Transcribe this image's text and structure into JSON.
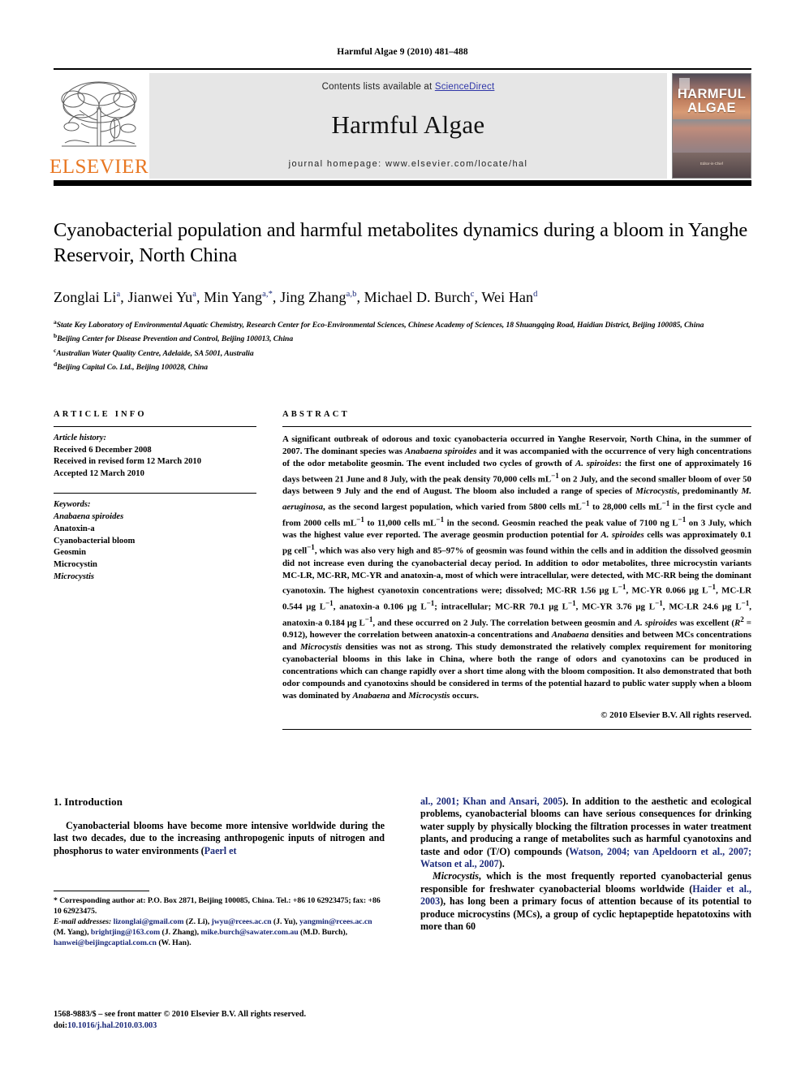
{
  "running_head": "Harmful Algae 9 (2010) 481–488",
  "masthead": {
    "contents_prefix": "Contents lists available at ",
    "sciencedirect": "ScienceDirect",
    "journal_title": "Harmful Algae",
    "homepage": "journal homepage: www.elsevier.com/locate/hal",
    "publisher_wordmark": "ELSEVIER",
    "cover": {
      "line1": "HARMFUL",
      "line2": "ALGAE",
      "footer": "Editor-in-Chief"
    }
  },
  "article": {
    "title": "Cyanobacterial population and harmful metabolites dynamics during a bloom in Yanghe Reservoir, North China",
    "authors_html": "Zonglai Li<sup>a</sup>, Jianwei Yu<sup>a</sup>, Min Yang<sup>a,*</sup>, Jing Zhang<sup>a,b</sup>, Michael D. Burch<sup>c</sup>, Wei Han<sup>d</sup>",
    "affiliations": [
      "<sup>a</sup>State Key Laboratory of Environmental Aquatic Chemistry, Research Center for Eco-Environmental Sciences, Chinese Academy of Sciences, 18 Shuangqing Road, Haidian District, Beijing 100085, China",
      "<sup>b</sup>Beijing Center for Disease Prevention and Control, Beijing 100013, China",
      "<sup>c</sup>Australian Water Quality Centre, Adelaide, SA 5001, Australia",
      "<sup>d</sup>Beijing Capital Co. Ltd., Beijing 100028, China"
    ]
  },
  "article_info": {
    "heading": "ARTICLE INFO",
    "history_label": "Article history:",
    "history": [
      "Received 6 December 2008",
      "Received in revised form 12 March 2010",
      "Accepted 12 March 2010"
    ],
    "keywords_label": "Keywords:",
    "keywords": [
      {
        "text": "Anabaena spiroides",
        "italic": true
      },
      {
        "text": "Anatoxin-a",
        "italic": false
      },
      {
        "text": "Cyanobacterial bloom",
        "italic": false
      },
      {
        "text": "Geosmin",
        "italic": false
      },
      {
        "text": "Microcystin",
        "italic": false
      },
      {
        "text": "Microcystis",
        "italic": true
      }
    ]
  },
  "abstract": {
    "heading": "ABSTRACT",
    "text_html": "A significant outbreak of odorous and toxic cyanobacteria occurred in Yanghe Reservoir, North China, in the summer of 2007. The dominant species was <i>Anabaena spiroides</i> and it was accompanied with the occurrence of very high concentrations of the odor metabolite geosmin. The event included two cycles of growth of <i>A. spiroides</i>: the first one of approximately 16 days between 21 June and 8 July, with the peak density 70,000 cells mL<sup>&minus;1</sup> on 2 July, and the second smaller bloom of over 50 days between 9 July and the end of August. The bloom also included a range of species of <i>Microcystis</i>, predominantly <i>M. aeruginosa</i>, as the second largest population, which varied from 5800 cells mL<sup>&minus;1</sup> to 28,000 cells mL<sup>&minus;1</sup> in the first cycle and from 2000 cells mL<sup>&minus;1</sup> to 11,000 cells mL<sup>&minus;1</sup> in the second. Geosmin reached the peak value of 7100 ng L<sup>&minus;1</sup> on 3 July, which was the highest value ever reported. The average geosmin production potential for <i>A. spiroides</i> cells was approximately 0.1 pg cell<sup>&minus;1</sup>, which was also very high and 85&ndash;97% of geosmin was found within the cells and in addition the dissolved geosmin did not increase even during the cyanobacterial decay period. In addition to odor metabolites, three microcystin variants MC-LR, MC-RR, MC-YR and anatoxin-a, most of which were intracellular, were detected, with MC-RR being the dominant cyanotoxin. The highest cyanotoxin concentrations were; dissolved; MC-RR 1.56 &mu;g L<sup>&minus;1</sup>, MC-YR 0.066 &mu;g L<sup>&minus;1</sup>, MC-LR 0.544 &mu;g L<sup>&minus;1</sup>, anatoxin-a 0.106 &mu;g L<sup>&minus;1</sup>; intracellular; MC-RR 70.1 &mu;g L<sup>&minus;1</sup>, MC-YR 3.76 &mu;g L<sup>&minus;1</sup>, MC-LR 24.6 &mu;g L<sup>&minus;1</sup>, anatoxin-a 0.184 &mu;g L<sup>&minus;1</sup>, and these occurred on 2 July. The correlation between geosmin and <i>A. spiroides</i> was excellent (<i>R</i><sup>2</sup> = 0.912), however the correlation between anatoxin-a concentrations and <i>Anabaena</i> densities and between MCs concentrations and <i>Microcystis</i> densities was not as strong. This study demonstrated the relatively complex requirement for monitoring cyanobacterial blooms in this lake in China, where both the range of odors and cyanotoxins can be produced in concentrations which can change rapidly over a short time along with the bloom composition. It also demonstrated that both odor compounds and cyanotoxins should be considered in terms of the potential hazard to public water supply when a bloom was dominated by <i>Anabaena</i> and <i>Microcystis</i> occurs.",
    "copyright": "© 2010 Elsevier B.V. All rights reserved."
  },
  "introduction": {
    "heading": "1. Introduction",
    "left_paragraph_html": "Cyanobacterial blooms have become more intensive worldwide during the last two decades, due to the increasing anthropogenic inputs of nitrogen and phosphorus to water environments (<span class=\"ref\">Paerl et</span>",
    "right_paragraph1_html": "<span class=\"ref\">al., 2001; Khan and Ansari, 2005</span>). In addition to the aesthetic and ecological problems, cyanobacterial blooms can have serious consequences for drinking water supply by physically blocking the filtration processes in water treatment plants, and producing a range of metabolites such as harmful cyanotoxins and taste and odor (T/O) compounds (<span class=\"ref\">Watson, 2004; van Apeldoorn et al., 2007; Watson et al., 2007</span>).",
    "right_paragraph2_html": "<i>Microcystis</i>, which is the most frequently reported cyanobacterial genus responsible for freshwater cyanobacterial blooms worldwide (<span class=\"ref\">Haider et al., 2003</span>), has long been a primary focus of attention because of its potential to produce microcystins (MCs), a group of cyclic heptapeptide hepatotoxins with more than 60"
  },
  "footnotes": {
    "corresponding_html": "* Corresponding author at: P.O. Box 2871, Beijing 100085, China. Tel.: +86 10 62923475; fax: +86 10 62923475.",
    "emails_html": "<i>E-mail addresses:</i> <span class=\"lnk\">lizonglai@gmail.com</span> (Z. Li), <span class=\"lnk\">jwyu@rcees.ac.cn</span> (J. Yu), <span class=\"lnk\">yangmin@rcees.ac.cn</span> (M. Yang), <span class=\"lnk\">brightjing@163.com</span> (J. Zhang), <span class=\"lnk\">mike.burch@sawater.com.au</span> (M.D. Burch), <span class=\"lnk\">hanwei@beijingcaptial.com.cn</span> (W. Han)."
  },
  "issn_line": {
    "text_html": "1568-9883/$ &ndash; see front matter © 2010 Elsevier B.V. All rights reserved.",
    "doi_html": "doi:<span class=\"lnk\">10.1016/j.hal.2010.03.003</span>"
  },
  "colors": {
    "link": "#1b2a7a",
    "sciencedirect": "#2f36a8",
    "elsevier_orange": "#e87722",
    "band_gray": "#e6e6e6"
  }
}
